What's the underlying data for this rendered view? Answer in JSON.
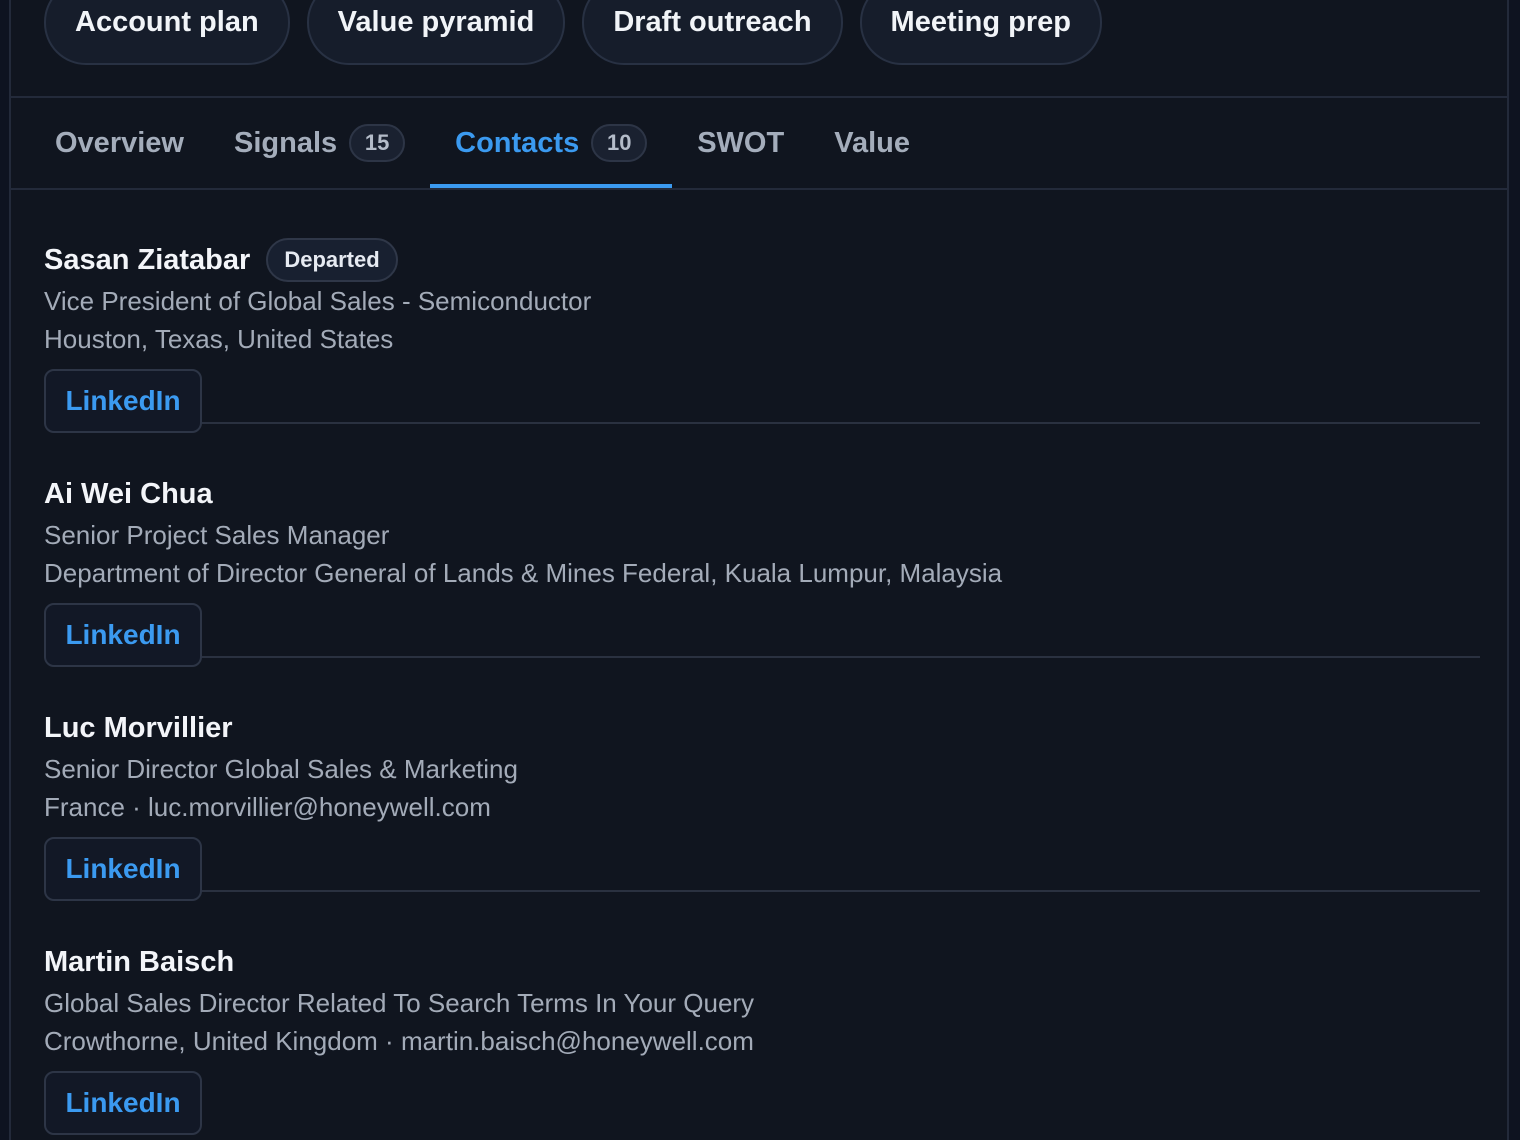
{
  "actions": [
    {
      "label": "Account plan"
    },
    {
      "label": "Value pyramid"
    },
    {
      "label": "Draft outreach"
    },
    {
      "label": "Meeting prep"
    }
  ],
  "tabs": [
    {
      "label": "Overview",
      "count": null,
      "active": false
    },
    {
      "label": "Signals",
      "count": "15",
      "active": false
    },
    {
      "label": "Contacts",
      "count": "10",
      "active": true
    },
    {
      "label": "SWOT",
      "count": null,
      "active": false
    },
    {
      "label": "Value",
      "count": null,
      "active": false
    }
  ],
  "contacts": [
    {
      "name": "Sasan Ziatabar",
      "badge": "Departed",
      "title": "Vice President of Global Sales - Semiconductor",
      "location": "Houston, Texas, United States",
      "link_label": "LinkedIn"
    },
    {
      "name": "Ai Wei Chua",
      "badge": null,
      "title": "Senior Project Sales Manager",
      "location": "Department of Director General of Lands & Mines Federal, Kuala Lumpur, Malaysia",
      "link_label": "LinkedIn"
    },
    {
      "name": "Luc Morvillier",
      "badge": null,
      "title": "Senior Director Global Sales & Marketing",
      "location": "France · luc.morvillier@honeywell.com",
      "link_label": "LinkedIn"
    },
    {
      "name": "Martin Baisch",
      "badge": null,
      "title": "Global Sales Director Related To Search Terms In Your Query",
      "location": "Crowthorne, United Kingdom · martin.baisch@honeywell.com",
      "link_label": "LinkedIn"
    }
  ],
  "colors": {
    "background": "#10151f",
    "accent": "#3b9af0",
    "border": "#232a3a"
  }
}
